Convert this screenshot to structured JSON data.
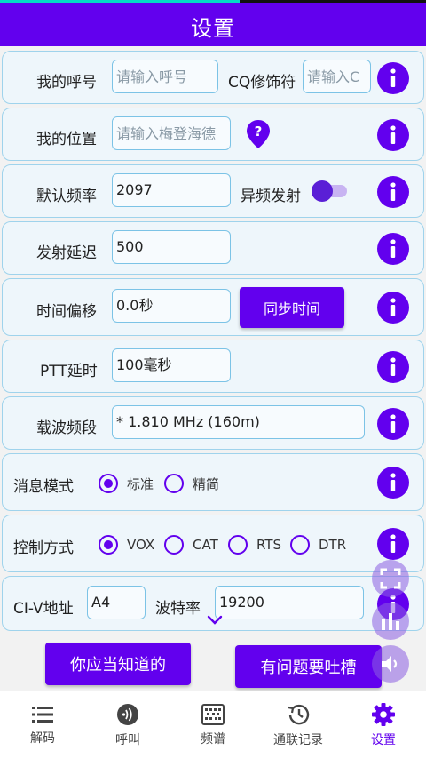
{
  "app": {
    "title": "设置"
  },
  "rows": {
    "callsign": {
      "label": "我的呼号",
      "placeholder": "请输入呼号",
      "cq_label": "CQ修饰符",
      "cq_placeholder": "请输入C"
    },
    "location": {
      "label": "我的位置",
      "placeholder": "请输入梅登海德"
    },
    "frequency": {
      "label": "默认频率",
      "value": "2097",
      "split_label": "异频发射",
      "split_on": true
    },
    "tx_delay": {
      "label": "发射延迟",
      "value": "500"
    },
    "time_offset": {
      "label": "时间偏移",
      "value": "0.0秒",
      "sync_label": "同步时间"
    },
    "ptt_delay": {
      "label": "PTT延时",
      "value": "100毫秒"
    },
    "band": {
      "label": "载波频段",
      "value": "* 1.810 MHz (160m)"
    },
    "message_mode": {
      "label": "消息模式",
      "options": [
        "标准",
        "精简"
      ],
      "selected": "标准"
    },
    "control": {
      "label": "控制方式",
      "options": [
        "VOX",
        "CAT",
        "RTS",
        "DTR"
      ],
      "selected": "VOX"
    },
    "civ": {
      "label": "CI-V地址",
      "value": "A4",
      "baud_label": "波特率",
      "baud_value": "19200"
    }
  },
  "actions": {
    "know_label": "你应当知道的",
    "feedback_label": "有问题要吐槽"
  },
  "nav": {
    "items": [
      {
        "label": "解码",
        "icon": "list-icon"
      },
      {
        "label": "呼叫",
        "icon": "radio-icon"
      },
      {
        "label": "频谱",
        "icon": "waterfall-icon"
      },
      {
        "label": "通联记录",
        "icon": "history-icon"
      },
      {
        "label": "设置",
        "icon": "gear-icon"
      }
    ],
    "active": "设置"
  },
  "colors": {
    "primary": "#6200ee",
    "card_bg": "#eef6fb",
    "card_border": "#9fd3ec"
  }
}
